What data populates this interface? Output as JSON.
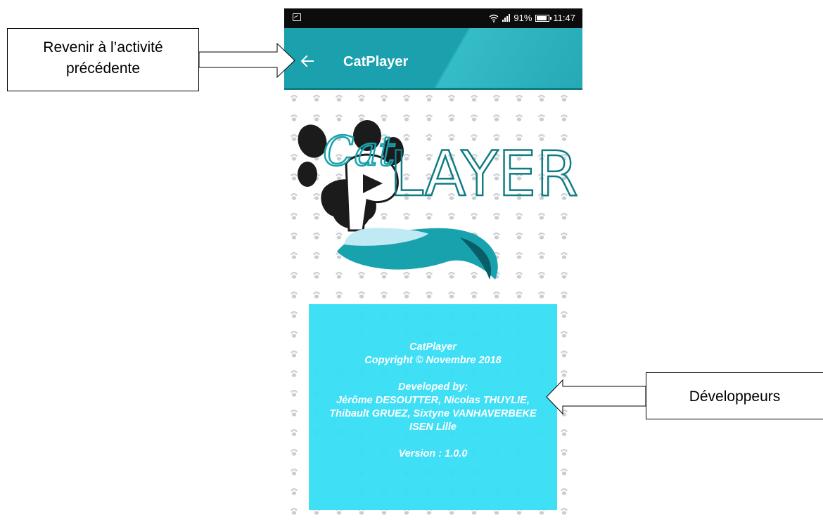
{
  "status_bar": {
    "battery": "91%",
    "time": "11:47"
  },
  "app_bar": {
    "title": "CatPlayer"
  },
  "logo": {
    "script_text": "Cat",
    "block_text": "LAYER"
  },
  "about": {
    "line1": "CatPlayer",
    "line2": "Copyright  © Novembre 2018",
    "line3": "Developed by:",
    "line4": "Jérôme DESOUTTER, Nicolas THUYLIE,",
    "line5": "Thibault GRUEZ, Sixtyne VANHAVERBEKE",
    "line6": "ISEN Lille",
    "line7": "Version : 1.0.0"
  },
  "callouts": {
    "back": {
      "line1": "Revenir à l’activité",
      "line2": "précédente"
    },
    "developers": "Développeurs"
  },
  "colors": {
    "app_bar": "#1aa1ad",
    "info_box": "#39def6",
    "status_bar": "#0c0c0c",
    "logo_teal": "#18a2ad",
    "logo_dark": "#1b1b1b"
  },
  "icons": [
    "gallery-icon",
    "wifi-icon",
    "signal-icon",
    "battery-icon",
    "back-arrow-icon",
    "paw-icon"
  ]
}
